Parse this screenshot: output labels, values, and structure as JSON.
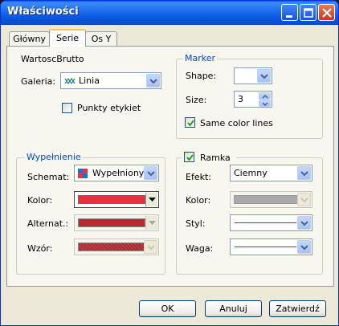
{
  "window": {
    "title": "Właściwości"
  },
  "tabs": [
    {
      "label": "Główny"
    },
    {
      "label": "Serie"
    },
    {
      "label": "Os Y"
    }
  ],
  "series_name": "WartoscBrutto",
  "galeria": {
    "label": "Galeria:",
    "value": "Linia"
  },
  "punkty_etykiet": {
    "label": "Punkty etykiet",
    "checked": false
  },
  "marker": {
    "legend": "Marker",
    "shape_label": "Shape:",
    "shape_value": "",
    "size_label": "Size:",
    "size_value": "3",
    "same_color_label": "Same color lines",
    "same_color_checked": true
  },
  "fill": {
    "legend": "Wypełnienie",
    "schemat_label": "Schemat:",
    "schemat_value": "Wypełniony",
    "kolor_label": "Kolor:",
    "kolor_color": "#e8303f",
    "alternat_label": "Alternat.:",
    "alternat_color": "#b52a33",
    "wzor_label": "Wzór:",
    "wzor_color": "#c23a40"
  },
  "ramka": {
    "label": "Ramka",
    "checked": true,
    "efekt_label": "Efekt:",
    "efekt_value": "Ciemny",
    "kolor_label": "Kolor:",
    "kolor_color": "#a8a8a8",
    "styl_label": "Styl:",
    "styl_color": "#c0222a",
    "waga_label": "Waga:",
    "waga_color": "#c0222a"
  },
  "buttons": {
    "ok": "OK",
    "cancel": "Anuluj",
    "apply": "Zatwierdź"
  },
  "colors": {
    "accent": "#0046d5",
    "titlebar": "#0b56e0"
  }
}
